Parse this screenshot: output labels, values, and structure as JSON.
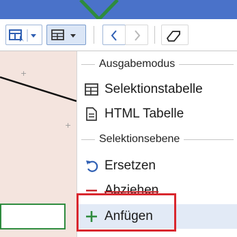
{
  "menu": {
    "sections": [
      {
        "title": "Ausgabemodus"
      },
      {
        "title": "Selektionsebene"
      }
    ],
    "items": [
      {
        "label": "Selektionstabelle",
        "icon": "table-icon"
      },
      {
        "label": "HTML Tabelle",
        "icon": "document-icon"
      },
      {
        "label": "Ersetzen",
        "icon": "undo-arrow-icon"
      },
      {
        "label": "Abziehen",
        "icon": "minus-icon"
      },
      {
        "label": "Anfügen",
        "icon": "plus-icon"
      }
    ]
  },
  "colors": {
    "accent_green": "#2e8b3e",
    "highlight_red": "#d9272e",
    "title_bar_blue": "#4a72c9",
    "minus_red": "#c8262c"
  }
}
